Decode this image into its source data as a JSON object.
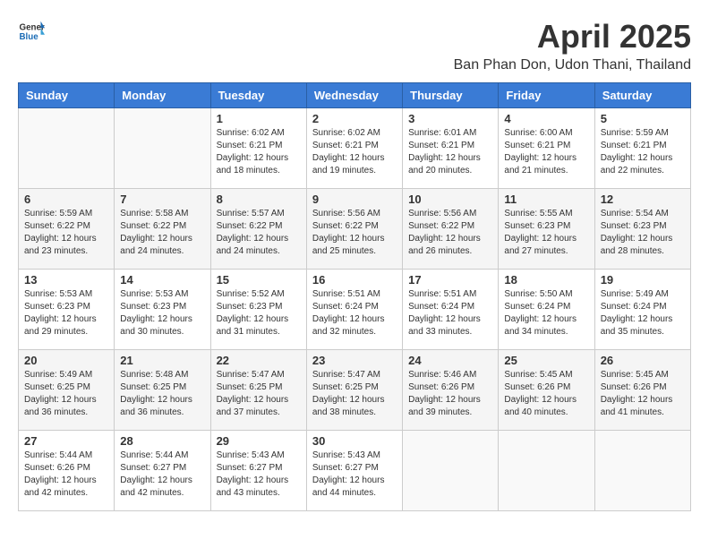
{
  "header": {
    "logo_general": "General",
    "logo_blue": "Blue",
    "title": "April 2025",
    "subtitle": "Ban Phan Don, Udon Thani, Thailand"
  },
  "days_of_week": [
    "Sunday",
    "Monday",
    "Tuesday",
    "Wednesday",
    "Thursday",
    "Friday",
    "Saturday"
  ],
  "weeks": [
    [
      {
        "day": "",
        "info": ""
      },
      {
        "day": "",
        "info": ""
      },
      {
        "day": "1",
        "info": "Sunrise: 6:02 AM\nSunset: 6:21 PM\nDaylight: 12 hours and 18 minutes."
      },
      {
        "day": "2",
        "info": "Sunrise: 6:02 AM\nSunset: 6:21 PM\nDaylight: 12 hours and 19 minutes."
      },
      {
        "day": "3",
        "info": "Sunrise: 6:01 AM\nSunset: 6:21 PM\nDaylight: 12 hours and 20 minutes."
      },
      {
        "day": "4",
        "info": "Sunrise: 6:00 AM\nSunset: 6:21 PM\nDaylight: 12 hours and 21 minutes."
      },
      {
        "day": "5",
        "info": "Sunrise: 5:59 AM\nSunset: 6:21 PM\nDaylight: 12 hours and 22 minutes."
      }
    ],
    [
      {
        "day": "6",
        "info": "Sunrise: 5:59 AM\nSunset: 6:22 PM\nDaylight: 12 hours and 23 minutes."
      },
      {
        "day": "7",
        "info": "Sunrise: 5:58 AM\nSunset: 6:22 PM\nDaylight: 12 hours and 24 minutes."
      },
      {
        "day": "8",
        "info": "Sunrise: 5:57 AM\nSunset: 6:22 PM\nDaylight: 12 hours and 24 minutes."
      },
      {
        "day": "9",
        "info": "Sunrise: 5:56 AM\nSunset: 6:22 PM\nDaylight: 12 hours and 25 minutes."
      },
      {
        "day": "10",
        "info": "Sunrise: 5:56 AM\nSunset: 6:22 PM\nDaylight: 12 hours and 26 minutes."
      },
      {
        "day": "11",
        "info": "Sunrise: 5:55 AM\nSunset: 6:23 PM\nDaylight: 12 hours and 27 minutes."
      },
      {
        "day": "12",
        "info": "Sunrise: 5:54 AM\nSunset: 6:23 PM\nDaylight: 12 hours and 28 minutes."
      }
    ],
    [
      {
        "day": "13",
        "info": "Sunrise: 5:53 AM\nSunset: 6:23 PM\nDaylight: 12 hours and 29 minutes."
      },
      {
        "day": "14",
        "info": "Sunrise: 5:53 AM\nSunset: 6:23 PM\nDaylight: 12 hours and 30 minutes."
      },
      {
        "day": "15",
        "info": "Sunrise: 5:52 AM\nSunset: 6:23 PM\nDaylight: 12 hours and 31 minutes."
      },
      {
        "day": "16",
        "info": "Sunrise: 5:51 AM\nSunset: 6:24 PM\nDaylight: 12 hours and 32 minutes."
      },
      {
        "day": "17",
        "info": "Sunrise: 5:51 AM\nSunset: 6:24 PM\nDaylight: 12 hours and 33 minutes."
      },
      {
        "day": "18",
        "info": "Sunrise: 5:50 AM\nSunset: 6:24 PM\nDaylight: 12 hours and 34 minutes."
      },
      {
        "day": "19",
        "info": "Sunrise: 5:49 AM\nSunset: 6:24 PM\nDaylight: 12 hours and 35 minutes."
      }
    ],
    [
      {
        "day": "20",
        "info": "Sunrise: 5:49 AM\nSunset: 6:25 PM\nDaylight: 12 hours and 36 minutes."
      },
      {
        "day": "21",
        "info": "Sunrise: 5:48 AM\nSunset: 6:25 PM\nDaylight: 12 hours and 36 minutes."
      },
      {
        "day": "22",
        "info": "Sunrise: 5:47 AM\nSunset: 6:25 PM\nDaylight: 12 hours and 37 minutes."
      },
      {
        "day": "23",
        "info": "Sunrise: 5:47 AM\nSunset: 6:25 PM\nDaylight: 12 hours and 38 minutes."
      },
      {
        "day": "24",
        "info": "Sunrise: 5:46 AM\nSunset: 6:26 PM\nDaylight: 12 hours and 39 minutes."
      },
      {
        "day": "25",
        "info": "Sunrise: 5:45 AM\nSunset: 6:26 PM\nDaylight: 12 hours and 40 minutes."
      },
      {
        "day": "26",
        "info": "Sunrise: 5:45 AM\nSunset: 6:26 PM\nDaylight: 12 hours and 41 minutes."
      }
    ],
    [
      {
        "day": "27",
        "info": "Sunrise: 5:44 AM\nSunset: 6:26 PM\nDaylight: 12 hours and 42 minutes."
      },
      {
        "day": "28",
        "info": "Sunrise: 5:44 AM\nSunset: 6:27 PM\nDaylight: 12 hours and 42 minutes."
      },
      {
        "day": "29",
        "info": "Sunrise: 5:43 AM\nSunset: 6:27 PM\nDaylight: 12 hours and 43 minutes."
      },
      {
        "day": "30",
        "info": "Sunrise: 5:43 AM\nSunset: 6:27 PM\nDaylight: 12 hours and 44 minutes."
      },
      {
        "day": "",
        "info": ""
      },
      {
        "day": "",
        "info": ""
      },
      {
        "day": "",
        "info": ""
      }
    ]
  ]
}
